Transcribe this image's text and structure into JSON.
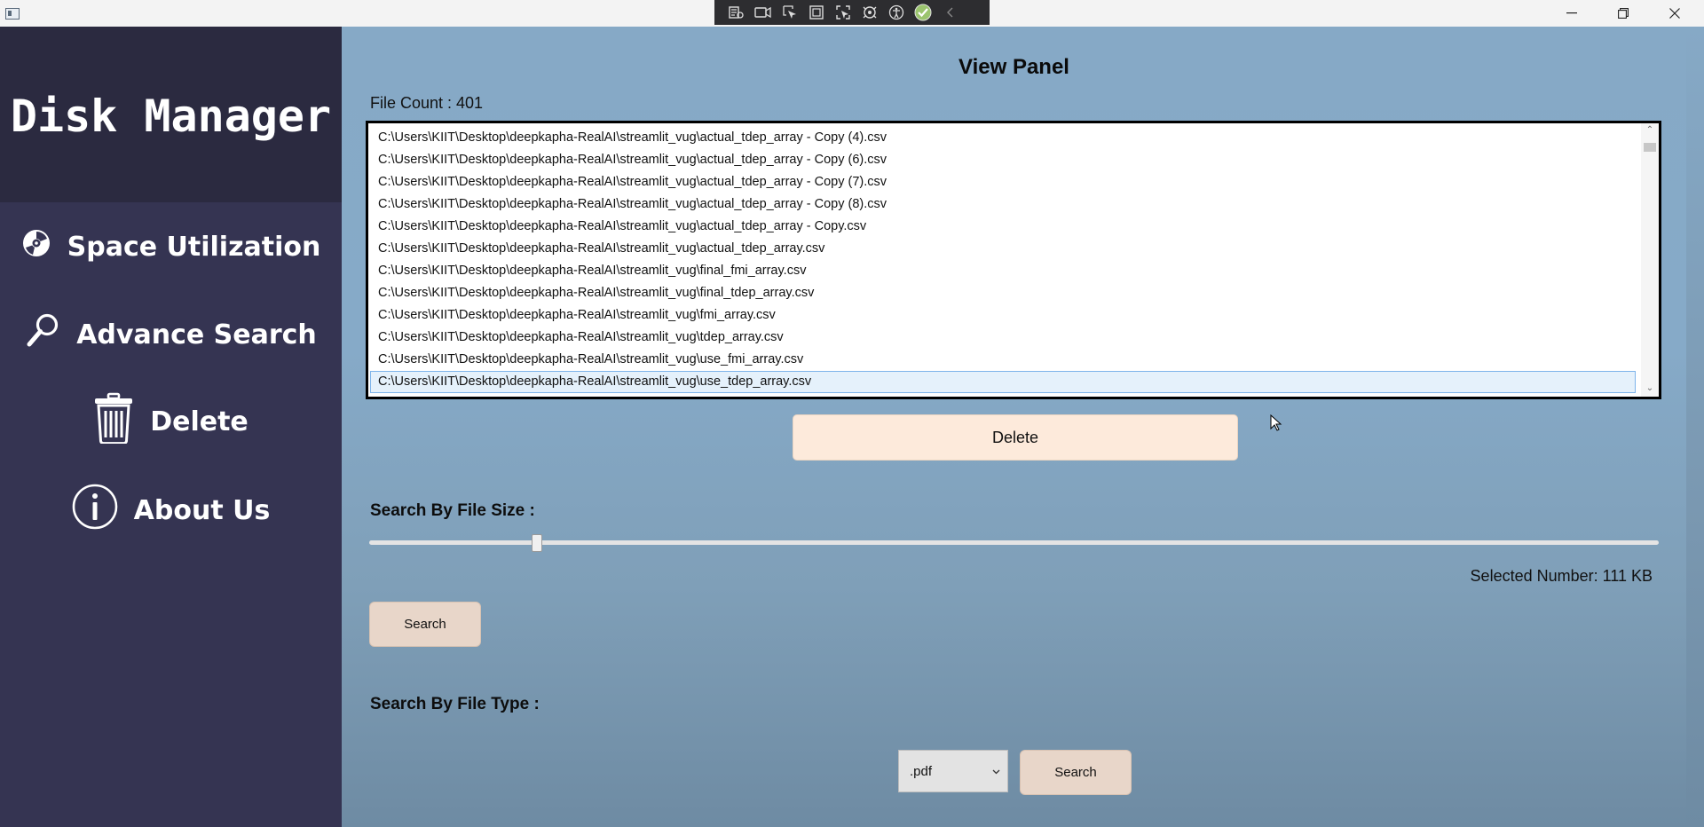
{
  "app": {
    "title": "Disk Manager"
  },
  "sidebar": {
    "items": [
      {
        "label": "Space Utilization",
        "icon": "disc-icon"
      },
      {
        "label": "Advance Search",
        "icon": "magnifier-icon"
      },
      {
        "label": "Delete",
        "icon": "trash-icon"
      },
      {
        "label": "About Us",
        "icon": "info-icon"
      }
    ]
  },
  "view": {
    "title": "View Panel",
    "file_count": "File Count : 401",
    "files": [
      "C:\\Users\\KIIT\\Desktop\\deepkapha-RealAI\\streamlit_vug\\actual_tdep_array - Copy (4).csv",
      "C:\\Users\\KIIT\\Desktop\\deepkapha-RealAI\\streamlit_vug\\actual_tdep_array - Copy (6).csv",
      "C:\\Users\\KIIT\\Desktop\\deepkapha-RealAI\\streamlit_vug\\actual_tdep_array - Copy (7).csv",
      "C:\\Users\\KIIT\\Desktop\\deepkapha-RealAI\\streamlit_vug\\actual_tdep_array - Copy (8).csv",
      "C:\\Users\\KIIT\\Desktop\\deepkapha-RealAI\\streamlit_vug\\actual_tdep_array - Copy.csv",
      "C:\\Users\\KIIT\\Desktop\\deepkapha-RealAI\\streamlit_vug\\actual_tdep_array.csv",
      "C:\\Users\\KIIT\\Desktop\\deepkapha-RealAI\\streamlit_vug\\final_fmi_array.csv",
      "C:\\Users\\KIIT\\Desktop\\deepkapha-RealAI\\streamlit_vug\\final_tdep_array.csv",
      "C:\\Users\\KIIT\\Desktop\\deepkapha-RealAI\\streamlit_vug\\fmi_array.csv",
      "C:\\Users\\KIIT\\Desktop\\deepkapha-RealAI\\streamlit_vug\\tdep_array.csv",
      "C:\\Users\\KIIT\\Desktop\\deepkapha-RealAI\\streamlit_vug\\use_fmi_array.csv",
      "C:\\Users\\KIIT\\Desktop\\deepkapha-RealAI\\streamlit_vug\\use_tdep_array.csv"
    ],
    "selected_index": 11,
    "delete_label": "Delete"
  },
  "size_search": {
    "label": "Search By File Size :",
    "slider_fraction": 0.13,
    "selected_number": "Selected Number: 111 KB",
    "search_label": "Search"
  },
  "type_search": {
    "label": "Search By File Type :",
    "selected_type": ".pdf",
    "search_label": "Search"
  },
  "colors": {
    "sidebar": "#353452",
    "sidebar_header": "#2b2a40",
    "delete_button": "#fdeadb",
    "search_button": "#e8d6c9"
  }
}
